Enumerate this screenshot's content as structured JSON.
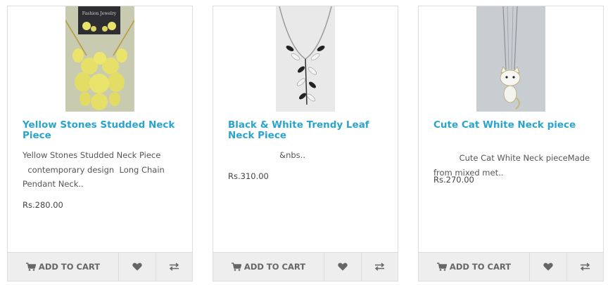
{
  "currency_note": "",
  "products": [
    {
      "name": "Yellow Stones Studded Neck Piece",
      "description": "Yellow Stones Studded Neck Piece\n  contemporary design  Long Chain Pendant Neck..",
      "price": "Rs.280.00",
      "image_label": "Fashion Jewelry",
      "add_to_cart_label": "ADD TO CART",
      "wishlist_icon": "heart-icon",
      "compare_icon": "compare-arrows-icon"
    },
    {
      "name": "Black & White Trendy Leaf Neck Piece",
      "description": "                    &nbs..",
      "price": "Rs.310.00",
      "add_to_cart_label": "ADD TO CART",
      "wishlist_icon": "heart-icon",
      "compare_icon": "compare-arrows-icon"
    },
    {
      "name": "Cute Cat White Neck piece",
      "description": "          Cute Cat White Neck pieceMade from mixed met..",
      "price": "Rs.270.00",
      "add_to_cart_label": "ADD TO CART",
      "wishlist_icon": "heart-icon",
      "compare_icon": "compare-arrows-icon"
    }
  ],
  "colors": {
    "title": "#2aa4cf",
    "text": "#555555",
    "button_bg": "#eeeeee",
    "border": "#dddddd"
  }
}
